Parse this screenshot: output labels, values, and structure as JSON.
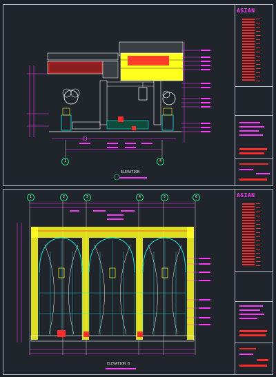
{
  "sheets": {
    "top": {
      "logo": "ASIAN",
      "view_label": "ELEVATION",
      "axis_labels": [
        "1",
        "4"
      ]
    },
    "bottom": {
      "logo": "ASIAN",
      "view_label": "ELEVATION B",
      "axis_labels": [
        "1",
        "2",
        "3",
        "4",
        "5",
        "6"
      ]
    }
  },
  "colors": {
    "linework": "#ffffff",
    "annotation": "#ff3cff",
    "hatch_yellow": "#ffff1e",
    "grid_bubble": "#22e07a",
    "accent_red": "#ff2a2a",
    "cyan": "#19e1e1"
  }
}
